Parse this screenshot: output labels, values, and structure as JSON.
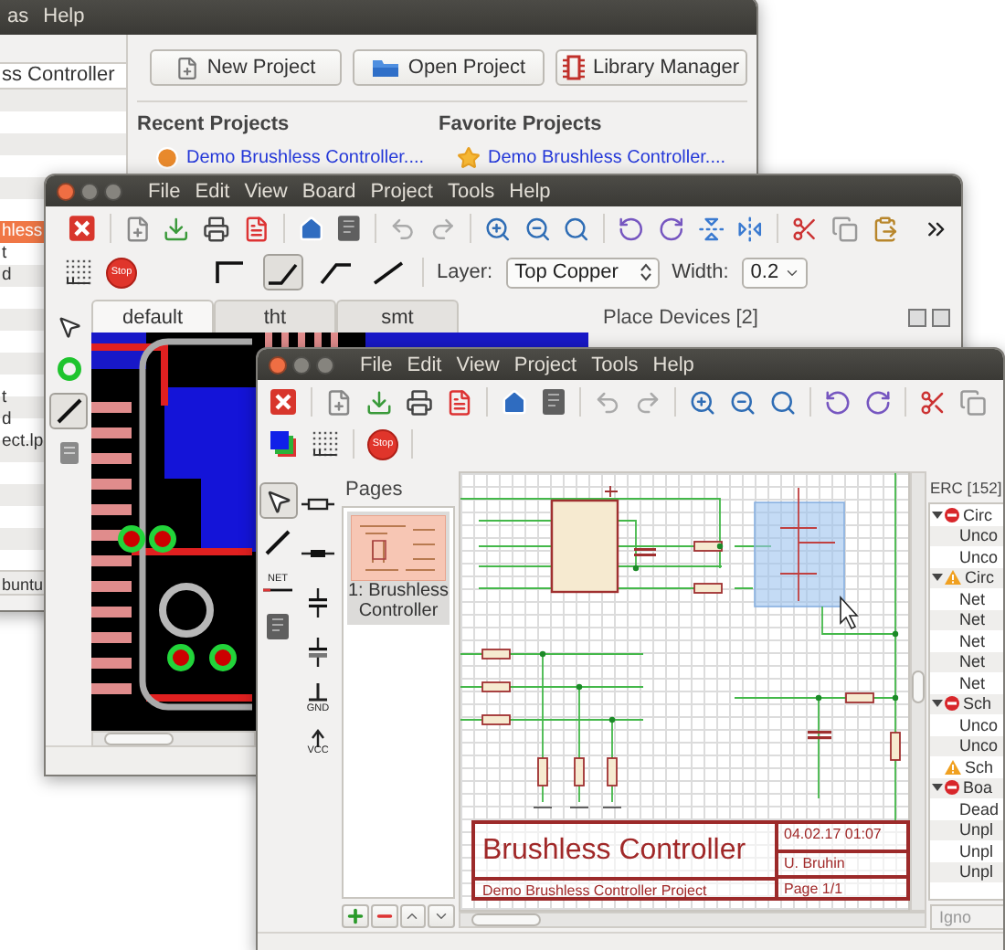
{
  "launcher": {
    "menu": [
      "as",
      "Help"
    ],
    "path": "ss Controller",
    "tree_groups": [
      [
        {
          "label": "hless",
          "selected": true
        },
        {
          "label": "t",
          "selected": false
        },
        {
          "label": "d",
          "selected": false
        }
      ],
      [
        {
          "label": "t",
          "selected": false
        },
        {
          "label": "d",
          "selected": false
        },
        {
          "label": "ect.lp",
          "selected": false
        }
      ]
    ],
    "status": "buntu",
    "buttons": [
      {
        "kind": "new",
        "label": "New Project"
      },
      {
        "kind": "open",
        "label": "Open Project"
      },
      {
        "kind": "library",
        "label": "Library Manager"
      }
    ],
    "recent": {
      "title": "Recent Projects",
      "items": [
        "Demo Brushless Controller...."
      ]
    },
    "favorites": {
      "title": "Favorite Projects",
      "items": [
        "Demo Brushless Controller...."
      ]
    }
  },
  "board_editor": {
    "menu": [
      "File",
      "Edit",
      "View",
      "Board",
      "Project",
      "Tools",
      "Help"
    ],
    "stop": "Stop",
    "wire_modes": [
      {
        "kind": "corner",
        "selected": false
      },
      {
        "kind": "bend_up",
        "selected": true
      },
      {
        "kind": "bend_flat",
        "selected": false
      },
      {
        "kind": "straight",
        "selected": false
      }
    ],
    "layer": {
      "label": "Layer:",
      "value": "Top Copper"
    },
    "width": {
      "label": "Width:",
      "value": "0.2"
    },
    "tools": [
      {
        "kind": "pointer",
        "selected": false
      },
      {
        "kind": "via",
        "selected": false
      },
      {
        "kind": "trace",
        "selected": true
      },
      {
        "kind": "component",
        "selected": false
      }
    ],
    "tabs": [
      {
        "label": "default",
        "selected": true
      },
      {
        "label": "tht",
        "selected": false
      },
      {
        "label": "smt",
        "selected": false
      }
    ],
    "dock_title": "Place Devices [2]"
  },
  "schematic_editor": {
    "menu": [
      "File",
      "Edit",
      "View",
      "Project",
      "Tools",
      "Help"
    ],
    "stop": "Stop",
    "tools": [
      {
        "kind": "pointer",
        "selected": true
      },
      {
        "kind": "wire",
        "selected": false
      },
      {
        "kind": "netlabel",
        "label": "NET",
        "selected": false
      },
      {
        "kind": "component",
        "selected": false
      }
    ],
    "symbols": [
      {
        "kind": "resistor"
      },
      {
        "kind": "diode"
      },
      {
        "kind": "capacitor"
      },
      {
        "kind": "polar_capacitor"
      },
      {
        "kind": "ground",
        "label": "GND"
      },
      {
        "kind": "supply",
        "label": "VCC"
      }
    ],
    "pages": {
      "title": "Pages",
      "items": [
        {
          "label": "1: Brushless Controller",
          "selected": true
        }
      ]
    },
    "title_block": {
      "title": "Brushless Controller",
      "subtitle": "Demo Brushless Controller Project",
      "date": "04.02.17 01:07",
      "author": "U. Bruhin",
      "page": "Page 1/1"
    },
    "erc": {
      "title": "ERC [152]",
      "button": "Igno",
      "items": [
        {
          "kind": "error",
          "label": "Circ",
          "expanded": true,
          "children": [
            {
              "label": "Unco"
            },
            {
              "label": "Unco"
            }
          ]
        },
        {
          "kind": "warning",
          "label": "Circ",
          "expanded": true,
          "children": [
            {
              "label": "Net"
            },
            {
              "label": "Net"
            },
            {
              "label": "Net"
            },
            {
              "label": "Net"
            },
            {
              "label": "Net"
            }
          ]
        },
        {
          "kind": "error",
          "label": "Sch",
          "expanded": true,
          "children": [
            {
              "label": "Unco"
            },
            {
              "label": "Unco"
            }
          ]
        },
        {
          "kind": "warning",
          "label": "Sch"
        },
        {
          "kind": "error",
          "label": "Boa",
          "expanded": true,
          "children": [
            {
              "label": "Dead"
            },
            {
              "label": "Unpl"
            },
            {
              "label": "Unpl"
            },
            {
              "label": "Unpl"
            }
          ]
        }
      ]
    }
  }
}
